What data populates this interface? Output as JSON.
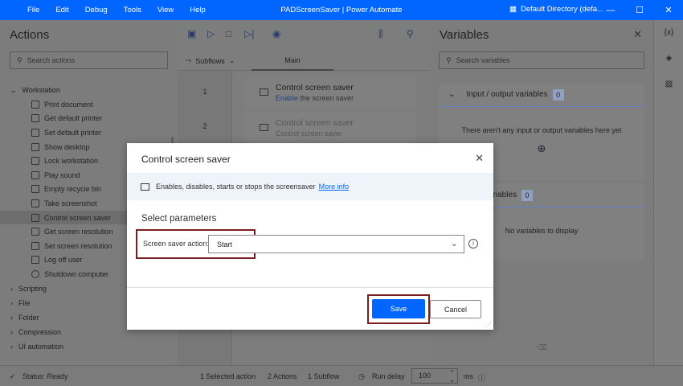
{
  "titlebar": {
    "menu": [
      "File",
      "Edit",
      "Debug",
      "Tools",
      "View",
      "Help"
    ],
    "app_title": "PADScreenSaver | Power Automate",
    "directory": "Default Directory (defa...",
    "minimize": "—",
    "maximize": "☐",
    "close": "✕"
  },
  "actions_panel": {
    "title": "Actions",
    "search_placeholder": "Search actions",
    "workstation_group": "Workstation",
    "items": [
      "Print document",
      "Get default printer",
      "Set default printer",
      "Show desktop",
      "Lock workstation",
      "Play sound",
      "Empty recycle bin",
      "Take screenshot",
      "Control screen saver",
      "Get screen resolution",
      "Set screen resolution",
      "Log off user",
      "Shutdown computer"
    ],
    "groups": [
      "Scripting",
      "File",
      "Folder",
      "Compression",
      "UI automation"
    ]
  },
  "flow": {
    "subflows_label": "Subflows",
    "main_tab": "Main",
    "steps": [
      {
        "line": "1",
        "title": "Control screen saver",
        "sub_bold": "Enable",
        "sub_rest": " the screen saver"
      },
      {
        "line": "2",
        "title": "Control screen saver",
        "sub": "Control screen saver"
      }
    ]
  },
  "variables_panel": {
    "title": "Variables",
    "search_placeholder": "Search variables",
    "io_title": "Input / output variables",
    "io_count": "0",
    "io_empty": "There aren't any input or output variables here yet",
    "flow_title": "ariables",
    "flow_count": "0",
    "flow_empty": "No variables to display"
  },
  "iconstrip": {
    "vars": "{x}"
  },
  "status": {
    "ready": "Status: Ready",
    "selected": "1 Selected action",
    "actions": "2 Actions",
    "subflow": "1 Subflow",
    "run_delay": "Run delay",
    "delay_value": "100",
    "unit": "ms"
  },
  "dialog": {
    "title": "Control screen saver",
    "close": "✕",
    "info_text": "Enables, disables, starts or stops the screensaver",
    "more_info": "More info",
    "section": "Select parameters",
    "param_label": "Screen saver action:",
    "param_value": "Start",
    "save": "Save",
    "cancel": "Cancel"
  },
  "colors": {
    "accent": "#0066ff",
    "highlight_box": "#7b1f22"
  }
}
